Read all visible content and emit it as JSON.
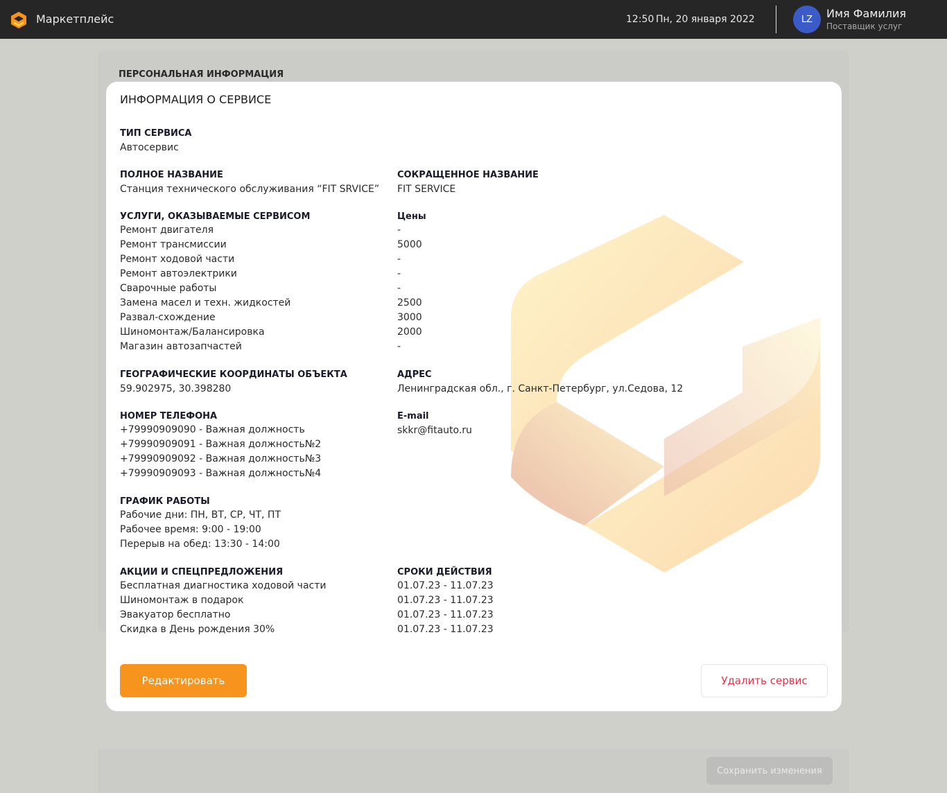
{
  "header": {
    "app_title": "Маркетплейс",
    "time": "12:50",
    "date": "Пн, 20 января 2022",
    "user": {
      "initials": "LZ",
      "name": "Имя Фамилия",
      "role": "Поставщик услуг"
    }
  },
  "background": {
    "section_title": "ПЕРСОНАЛЬНАЯ ИНФОРМАЦИЯ",
    "save_label": "Сохранить изменения"
  },
  "modal": {
    "title": "ИНФОРМАЦИЯ О СЕРВИСЕ",
    "service_type": {
      "label": "ТИП СЕРВИСА",
      "value": "Автосервис"
    },
    "full_name": {
      "label": "ПОЛНОЕ НАЗВАНИЕ",
      "value": "Станция технического обслуживания “FIT SRVICE”"
    },
    "short_name": {
      "label": "СОКРАЩЕННОЕ НАЗВАНИЕ",
      "value": "FIT SERVICE"
    },
    "services": {
      "label": "УСЛУГИ, ОКАЗЫВАЕМЫЕ СЕРВИСОМ",
      "prices_label": "Цены",
      "items": [
        {
          "name": "Ремонт двигателя",
          "price": "-"
        },
        {
          "name": "Ремонт трансмиссии",
          "price": "5000"
        },
        {
          "name": "Ремонт ходовой части",
          "price": "-"
        },
        {
          "name": "Ремонт автоэлектрики",
          "price": "-"
        },
        {
          "name": "Сварочные работы",
          "price": "-"
        },
        {
          "name": "Замена масел и техн. жидкостей",
          "price": "2500"
        },
        {
          "name": "Развал-схождение",
          "price": "3000"
        },
        {
          "name": "Шиномонтаж/Балансировка",
          "price": "2000"
        },
        {
          "name": "Магазин автозапчастей",
          "price": "-"
        }
      ]
    },
    "coords": {
      "label": "ГЕОГРАФИЧЕСКИЕ КООРДИНАТЫ ОБЪЕКТА",
      "value": "59.902975, 30.398280"
    },
    "address": {
      "label": "АДРЕС",
      "value": "Ленинградская обл., г. Санкт-Петербург, ул.Седова, 12"
    },
    "phones": {
      "label": "НОМЕР ТЕЛЕФОНА",
      "items": [
        "+79990909090 - Важная должность",
        "+79990909091 - Важная должность№2",
        "+79990909092 - Важная должность№3",
        "+79990909093 - Важная должность№4"
      ]
    },
    "email": {
      "label": "E-mail",
      "value": "skkr@fitauto.ru"
    },
    "schedule": {
      "label": "ГРАФИК РАБОТЫ",
      "items": [
        "Рабочие дни: ПН, ВТ, СР, ЧТ, ПТ",
        "Рабочее время: 9:00 - 19:00",
        "Перерыв на обед: 13:30 - 14:00"
      ]
    },
    "promos": {
      "label": "АКЦИИ И СПЕЦПРЕДЛОЖЕНИЯ",
      "period_label": "СРОКИ ДЕЙСТВИЯ",
      "items": [
        {
          "name": "Бесплатная диагностика ходовой части",
          "period": "01.07.23 - 11.07.23"
        },
        {
          "name": "Шиномонтаж в подарок",
          "period": "01.07.23 - 11.07.23"
        },
        {
          "name": "Эвакуатор бесплатно",
          "period": "01.07.23 - 11.07.23"
        },
        {
          "name": "Скидка в День рождения 30%",
          "period": "01.07.23 - 11.07.23"
        }
      ]
    },
    "edit_label": "Редактировать",
    "delete_label": "Удалить сервис"
  },
  "colors": {
    "accent": "#f7941d",
    "danger": "#e0364a",
    "topbar": "#262626",
    "avatar": "#3b5bc9"
  }
}
